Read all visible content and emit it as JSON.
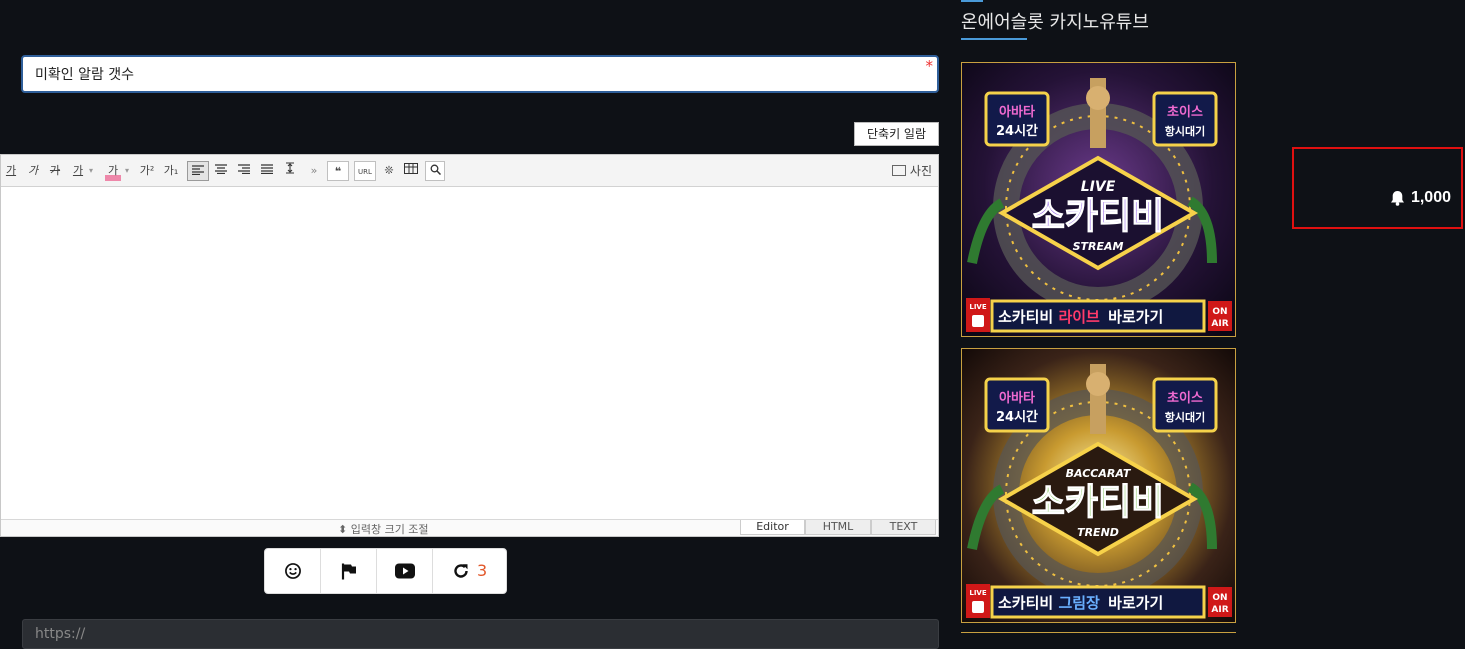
{
  "form": {
    "subject_value": "미확인 알람 갯수",
    "required_mark": "*",
    "shortcut_button": "단축키 일람",
    "url_placeholder": "https://"
  },
  "editor": {
    "toolbar": [
      {
        "name": "font-size-tool",
        "label": "가"
      },
      {
        "name": "italic-tool",
        "label": "가"
      },
      {
        "name": "strikethrough-tool",
        "label": "가"
      },
      {
        "name": "underline-tool",
        "label": "가"
      },
      {
        "name": "highlight-tool",
        "label": "가"
      },
      {
        "name": "superscript-tool",
        "label": "가²"
      },
      {
        "name": "subscript-tool",
        "label": "가₁"
      }
    ],
    "photo_label": "사진",
    "resize_label": "입력창 크기 조절",
    "modes": [
      "Editor",
      "HTML",
      "TEXT"
    ]
  },
  "actions": {
    "refresh_count": "3"
  },
  "sidebar": {
    "title": "온에어슬롯 카지노유튜브",
    "banners": [
      {
        "badge_left": [
          "아바타",
          "24시간"
        ],
        "badge_right": [
          "초이스",
          "항시대기"
        ],
        "top_word": "LIVE",
        "main": "소카티비",
        "sub": "STREAM",
        "cta_prefix": "소카티비",
        "cta_highlight": "라이브",
        "cta_suffix": "바로가기",
        "live_tag": "LIVE",
        "onair_tag": [
          "ON",
          "AIR"
        ]
      },
      {
        "badge_left": [
          "아바타",
          "24시간"
        ],
        "badge_right": [
          "초이스",
          "항시대기"
        ],
        "top_word": "BACCARAT",
        "main": "소카티비",
        "sub": "TREND",
        "cta_prefix": "소카티비",
        "cta_highlight": "그림장",
        "cta_suffix": "바로가기",
        "live_tag": "LIVE",
        "onair_tag": [
          "ON",
          "AIR"
        ]
      }
    ]
  },
  "notification": {
    "count": "1,000"
  },
  "colors": {
    "background": "#0e1116",
    "accent": "#4a9ad8",
    "refresh_count": "#e2582b",
    "highlight_box": "#e01010"
  }
}
